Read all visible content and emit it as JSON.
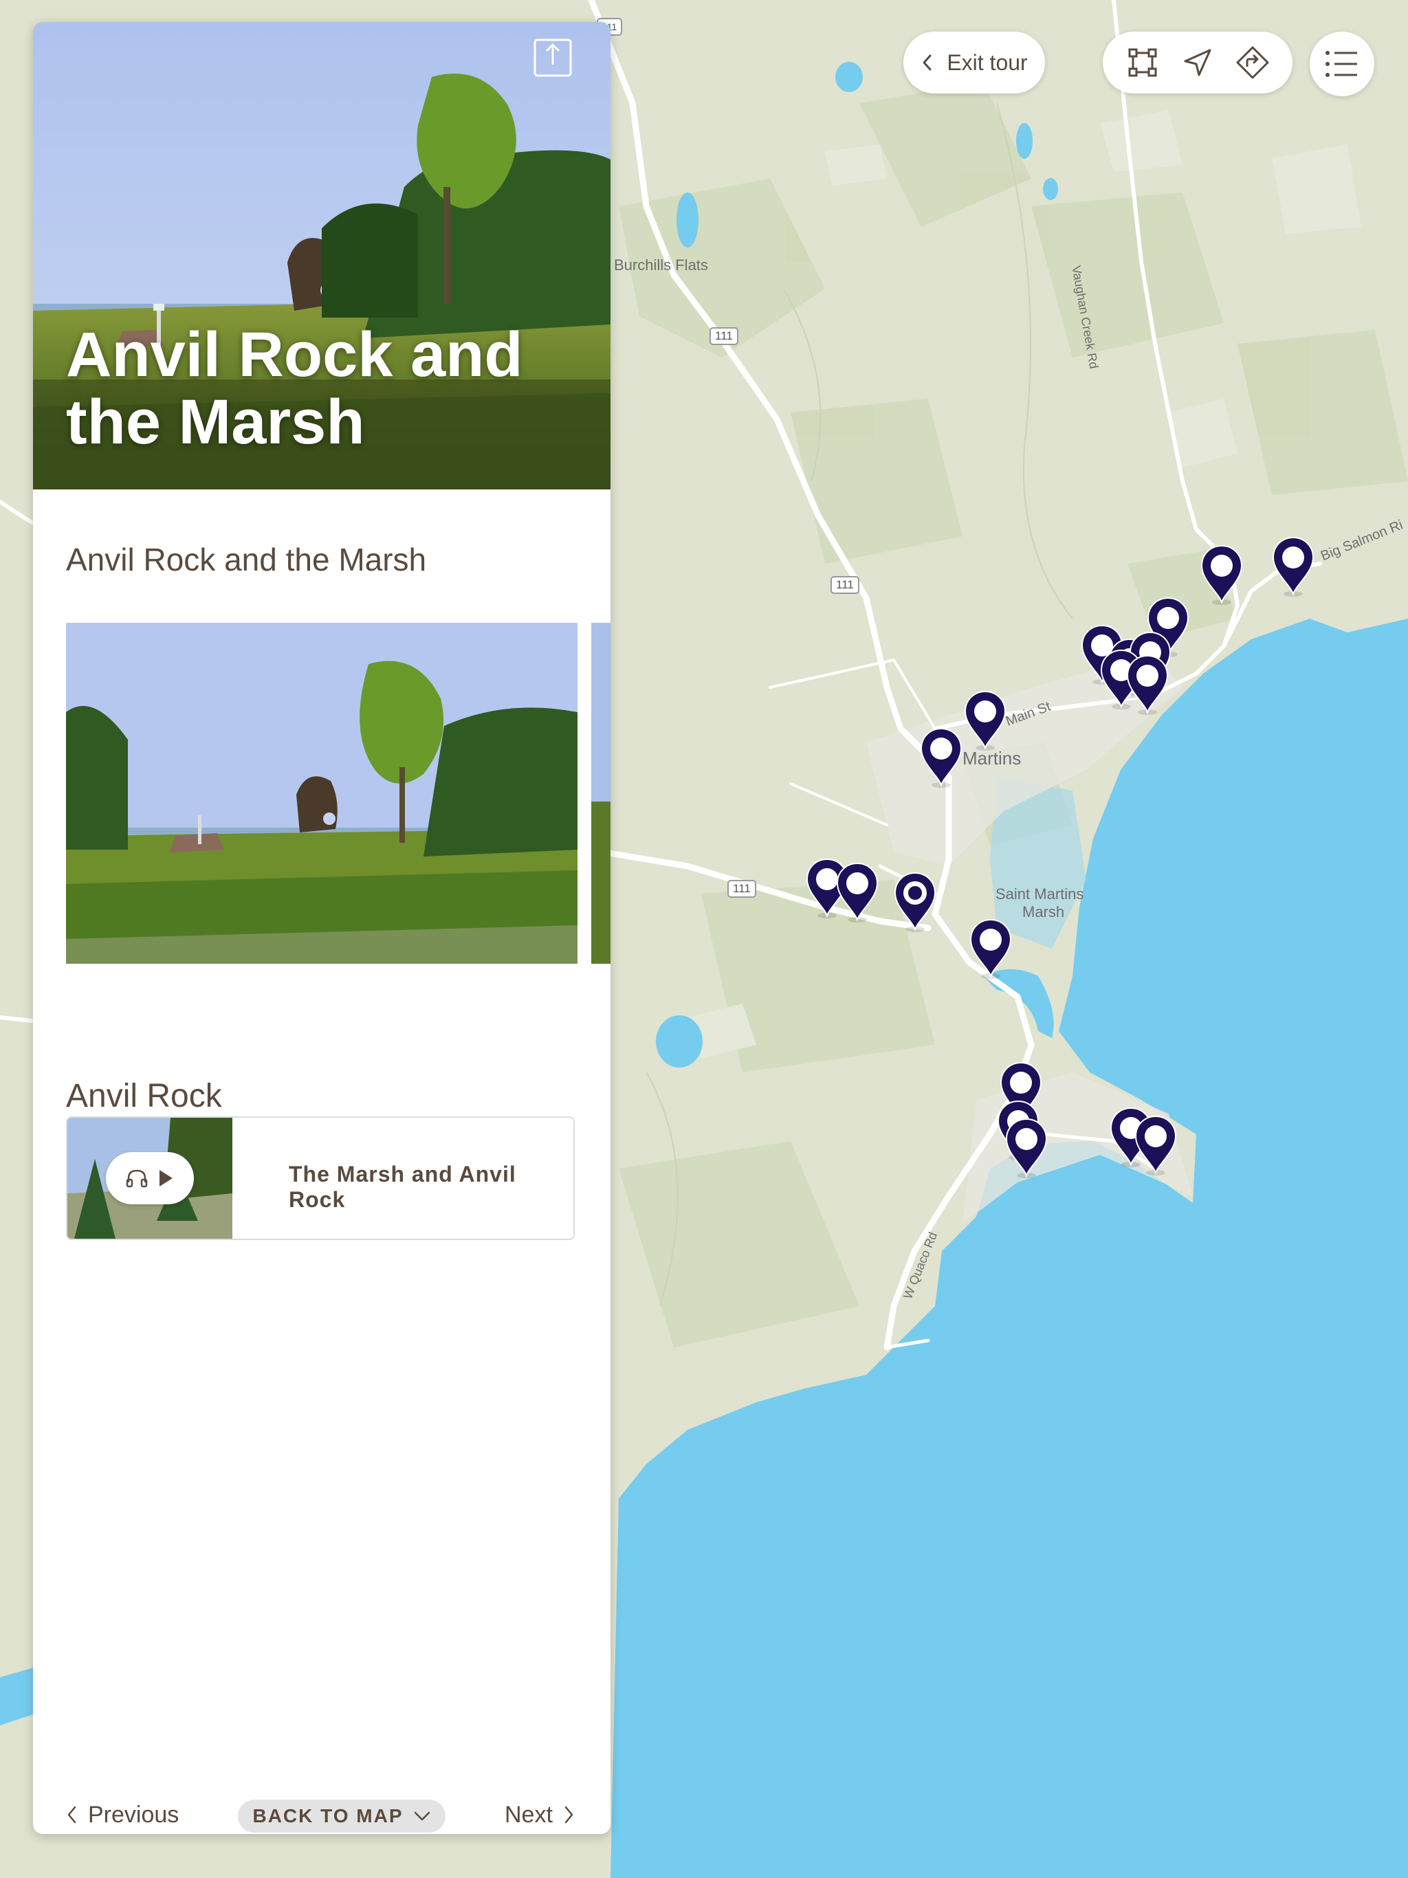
{
  "map": {
    "labels": {
      "burchills": "Burchills Flats",
      "vaughan": "Vaughan Creek Rd",
      "big_salmon": "Big Salmon Ri",
      "main_st": "Main St",
      "martins": "Martins",
      "marsh_line1": "Saint Martins",
      "marsh_line2": "Marsh",
      "quaco": "W Quaco Rd"
    },
    "highway": "111",
    "colors": {
      "land": "#dfe3cf",
      "forest": "#d2d9bc",
      "water": "#75ccee",
      "road": "#ffffff",
      "pin": "#1c1058"
    },
    "pin_count": 19,
    "selected_pin_style": "dot"
  },
  "controls": {
    "exit_tour": "Exit tour",
    "tools": [
      "fit-bounds-icon",
      "locate-icon",
      "directions-icon"
    ],
    "menu": "list-menu-icon"
  },
  "panel": {
    "hero_title": "Anvil Rock and the Marsh",
    "stop_heading": "Anvil Rock and the Marsh",
    "section_heading": "Anvil Rock",
    "audio_title": "The Marsh and Anvil Rock",
    "nav": {
      "previous": "Previous",
      "back_to_map": "BACK TO MAP",
      "next": "Next"
    }
  }
}
